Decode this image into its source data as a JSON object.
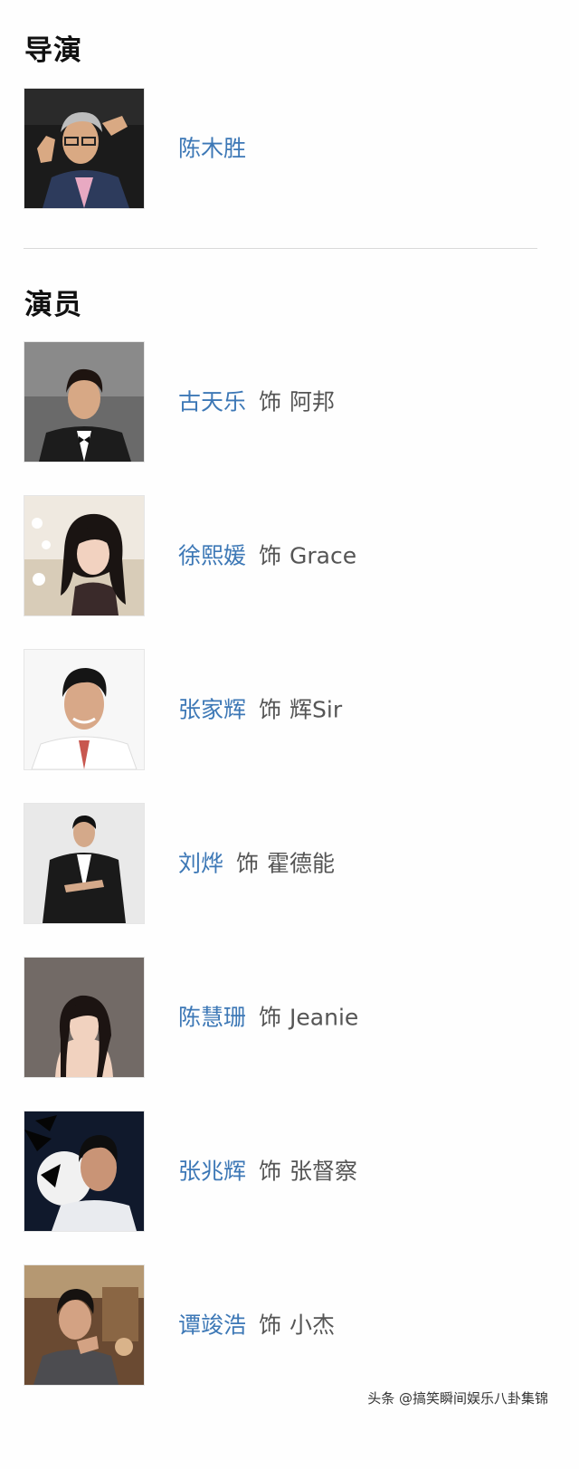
{
  "directors": {
    "title": "导演",
    "people": [
      {
        "name": "陈木胜"
      }
    ]
  },
  "cast": {
    "title": "演员",
    "role_prefix": "饰",
    "people": [
      {
        "name": "古天乐",
        "role": "阿邦"
      },
      {
        "name": "徐熙媛",
        "role": "Grace"
      },
      {
        "name": "张家辉",
        "role": "辉Sir"
      },
      {
        "name": "刘烨",
        "role": "霍德能"
      },
      {
        "name": "陈慧珊",
        "role": "Jeanie"
      },
      {
        "name": "张兆辉",
        "role": "张督察"
      },
      {
        "name": "谭竣浩",
        "role": "小杰"
      }
    ]
  },
  "watermark": "头条 @搞笑瞬间娱乐八卦集锦",
  "colors": {
    "link": "#3d78b6",
    "text": "#555555",
    "divider": "#d9d9d9"
  }
}
